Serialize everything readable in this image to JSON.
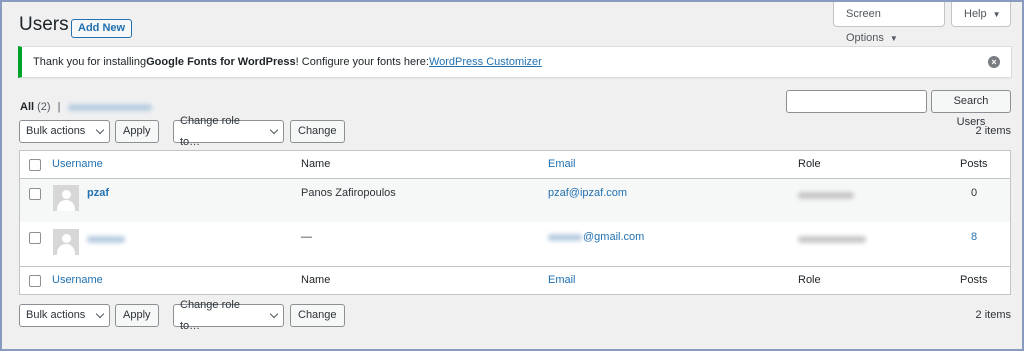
{
  "page": {
    "title": "Users",
    "add_new": "Add New"
  },
  "screen_tabs": {
    "screen_options": "Screen Options",
    "help": "Help",
    "caret": "▼"
  },
  "notice": {
    "prefix": "Thank you for installing ",
    "plugin": "Google Fonts for WordPress",
    "middle": "! Configure your fonts here: ",
    "link": "WordPress Customizer",
    "dismiss": "×"
  },
  "filters": {
    "all_label": "All",
    "all_count": "(2)",
    "separator": "|"
  },
  "search": {
    "button": "Search Users",
    "value": ""
  },
  "tablenav": {
    "bulk_actions": "Bulk actions",
    "apply": "Apply",
    "change_role": "Change role to…",
    "change": "Change",
    "count": "2 items"
  },
  "table": {
    "columns": [
      "Username",
      "Name",
      "Email",
      "Role",
      "Posts"
    ],
    "rows": [
      {
        "username": "pzaf",
        "name": "Panos Zafiropoulos",
        "email": "pzaf@ipzaf.com",
        "posts": "0"
      },
      {
        "username": "",
        "name": "—",
        "email_visible": "@gmail.com",
        "posts": "8"
      }
    ]
  },
  "colors": {
    "accent": "#2271b1",
    "notice_border": "#00a32a",
    "background": "#f0f0f1"
  }
}
